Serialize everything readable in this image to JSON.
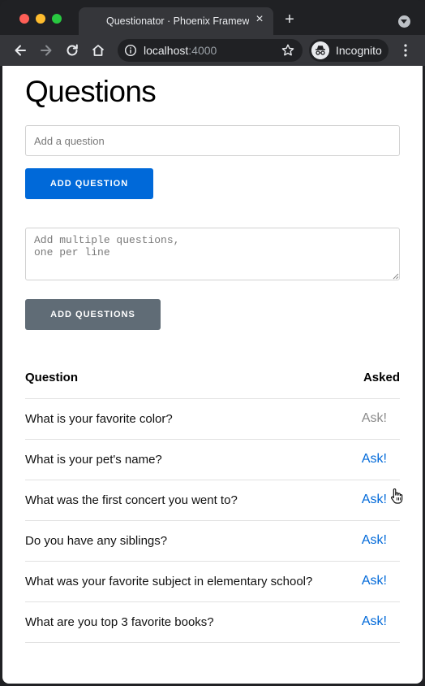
{
  "browser": {
    "tab_title": "Questionator · Phoenix Framework",
    "url_host": "localhost",
    "url_port": ":4000",
    "incognito_label": "Incognito"
  },
  "page": {
    "title": "Questions",
    "add_input_placeholder": "Add a question",
    "add_button_label": "ADD QUESTION",
    "multi_placeholder": "Add multiple questions,\none per line",
    "multi_button_label": "ADD QUESTIONS",
    "table": {
      "header_question": "Question",
      "header_asked": "Asked",
      "rows": [
        {
          "question": "What is your favorite color?",
          "ask": "Ask!"
        },
        {
          "question": "What is your pet's name?",
          "ask": "Ask!"
        },
        {
          "question": "What was the first concert you went to?",
          "ask": "Ask!"
        },
        {
          "question": "Do you have any siblings?",
          "ask": "Ask!"
        },
        {
          "question": "What was your favorite subject in elementary school?",
          "ask": "Ask!"
        },
        {
          "question": "What are you top 3 favorite books?",
          "ask": "Ask!"
        }
      ]
    }
  },
  "colors": {
    "primary": "#0069d9",
    "secondary": "#606c76",
    "link": "#0069d9",
    "link_hover": "#8a8a8a"
  }
}
